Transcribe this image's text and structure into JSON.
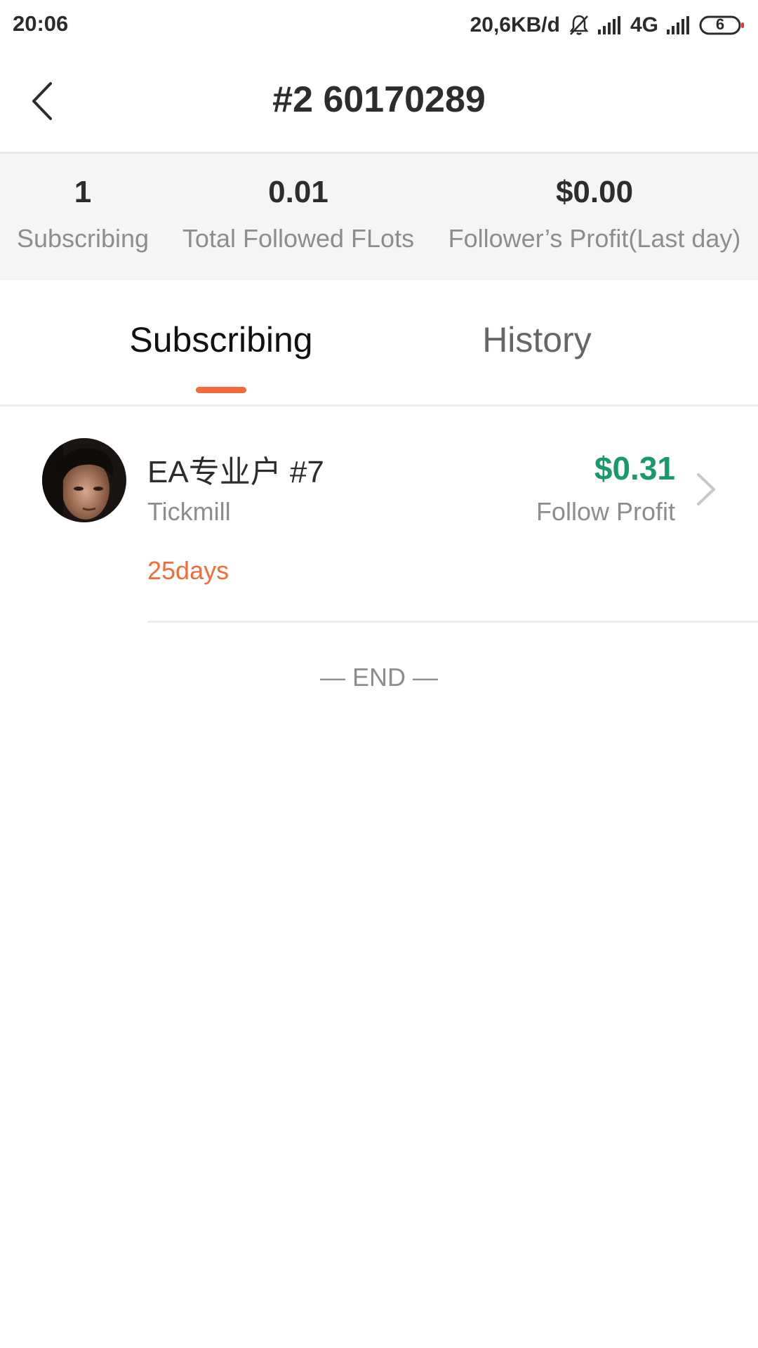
{
  "status_bar": {
    "time": "20:06",
    "network_speed": "20,6KB/d",
    "network_type": "4G",
    "battery_level": "6",
    "icons": [
      "bell-muted-icon",
      "signal-icon",
      "signal-icon",
      "battery-icon"
    ]
  },
  "header": {
    "title": "#2 60170289",
    "back_icon": "chevron-left-icon"
  },
  "stats": [
    {
      "value": "1",
      "label": "Subscribing"
    },
    {
      "value": "0.01",
      "label": "Total Followed FLots"
    },
    {
      "value": "$0.00",
      "label": "Follower’s Profit(Last day)"
    }
  ],
  "tabs": [
    {
      "label": "Subscribing",
      "active": true
    },
    {
      "label": "History",
      "active": false
    }
  ],
  "list": [
    {
      "name": "EA专业户  #7",
      "broker": "Tickmill",
      "duration": "25days",
      "profit": "$0.31",
      "profit_label": "Follow Profit"
    }
  ],
  "end_text": "— END —",
  "colors": {
    "accent": "#f26b3a",
    "profit_green": "#1a9a6c",
    "stats_bg": "#f5f5f5",
    "muted_text": "#8d8d8d"
  }
}
